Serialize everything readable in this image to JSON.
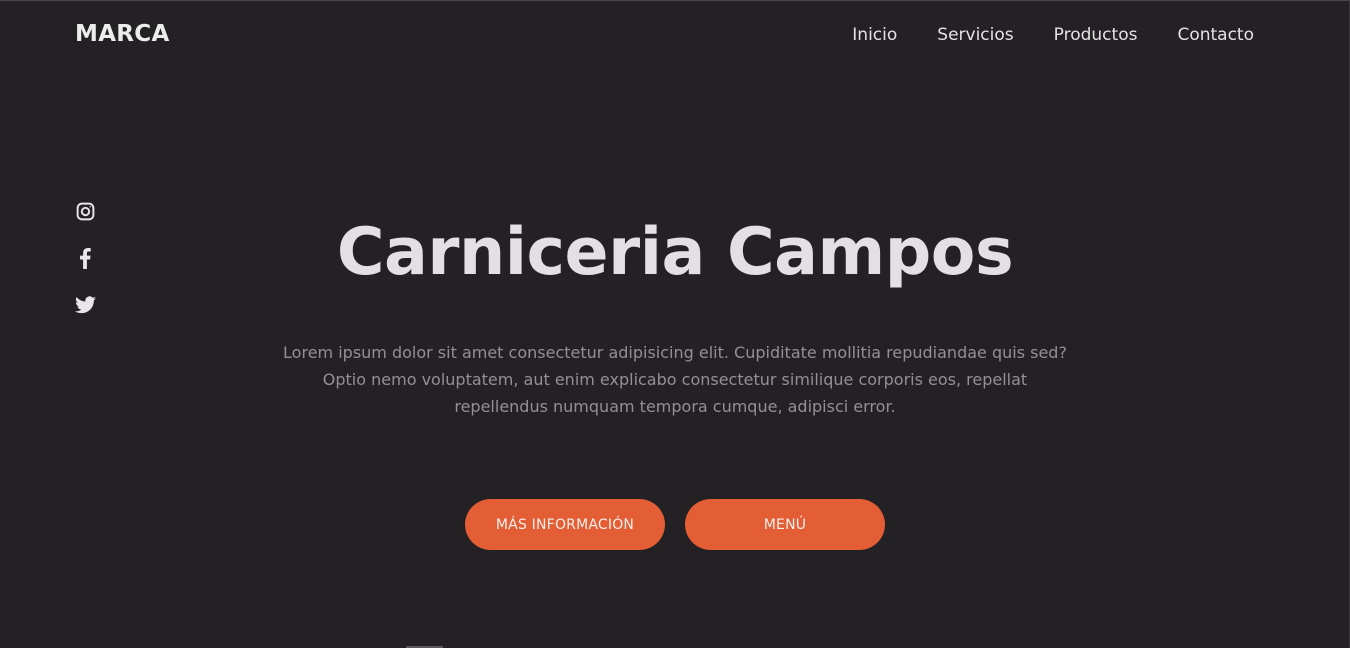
{
  "header": {
    "brand": "MARCA",
    "nav": [
      {
        "label": "Inicio"
      },
      {
        "label": "Servicios"
      },
      {
        "label": "Productos"
      },
      {
        "label": "Contacto"
      }
    ]
  },
  "social": {
    "icons": [
      "instagram-icon",
      "facebook-icon",
      "twitter-icon"
    ]
  },
  "hero": {
    "title": "Carniceria Campos",
    "text": "Lorem ipsum dolor sit amet consectetur adipisicing elit. Cupiditate mollitia repudiandae quis sed? Optio nemo voluptatem, aut enim explicabo consectetur similique corporis eos, repellat repellendus numquam tempora cumque, adipisci error.",
    "primary_button": "MÁS INFORMACIÓN",
    "secondary_button": "MENÚ"
  },
  "colors": {
    "background": "#242124",
    "accent": "#e35d35",
    "text_light": "#e2e0e2",
    "text_muted": "#958f93"
  }
}
